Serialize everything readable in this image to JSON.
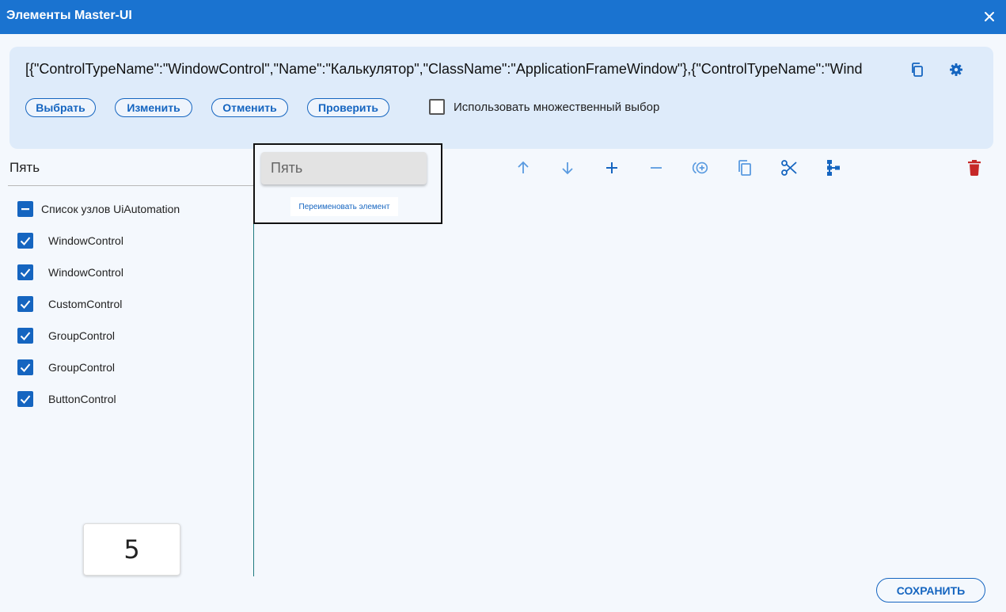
{
  "window": {
    "title": "Элементы Master-UI",
    "accent_color": "#1a73d0"
  },
  "selector": {
    "text": "[{\"ControlTypeName\":\"WindowControl\",\"Name\":\"Калькулятор\",\"ClassName\":\"ApplicationFrameWindow\"},{\"ControlTypeName\":\"WindowControl\",\"Name\":\"Калькулятор\"}]",
    "copy_icon": "copy-icon",
    "settings_icon": "gear-icon"
  },
  "actions": {
    "select": "Выбрать",
    "change": "Изменить",
    "cancel": "Отменить",
    "check": "Проверить"
  },
  "multi_select": {
    "label": "Использовать множественный выбор",
    "checked": false
  },
  "tree": {
    "title": "Пять",
    "root": "Список узлов UiAutomation",
    "items": [
      "WindowControl",
      "WindowControl",
      "CustomControl",
      "GroupControl",
      "GroupControl",
      "ButtonControl"
    ]
  },
  "preview": {
    "value": "5"
  },
  "rename": {
    "input_value": "Пять",
    "button_label": "Переименовать элемент"
  },
  "toolbar": {
    "icons": [
      "arrow-up-icon",
      "arrow-down-icon",
      "plus-icon",
      "minus-icon",
      "add-circle-icon",
      "copy-icon",
      "scissors-icon",
      "tree-icon",
      "trash-icon"
    ],
    "delete_color": "#c62828"
  },
  "footer": {
    "save_label": "СОХРАНИТЬ"
  }
}
